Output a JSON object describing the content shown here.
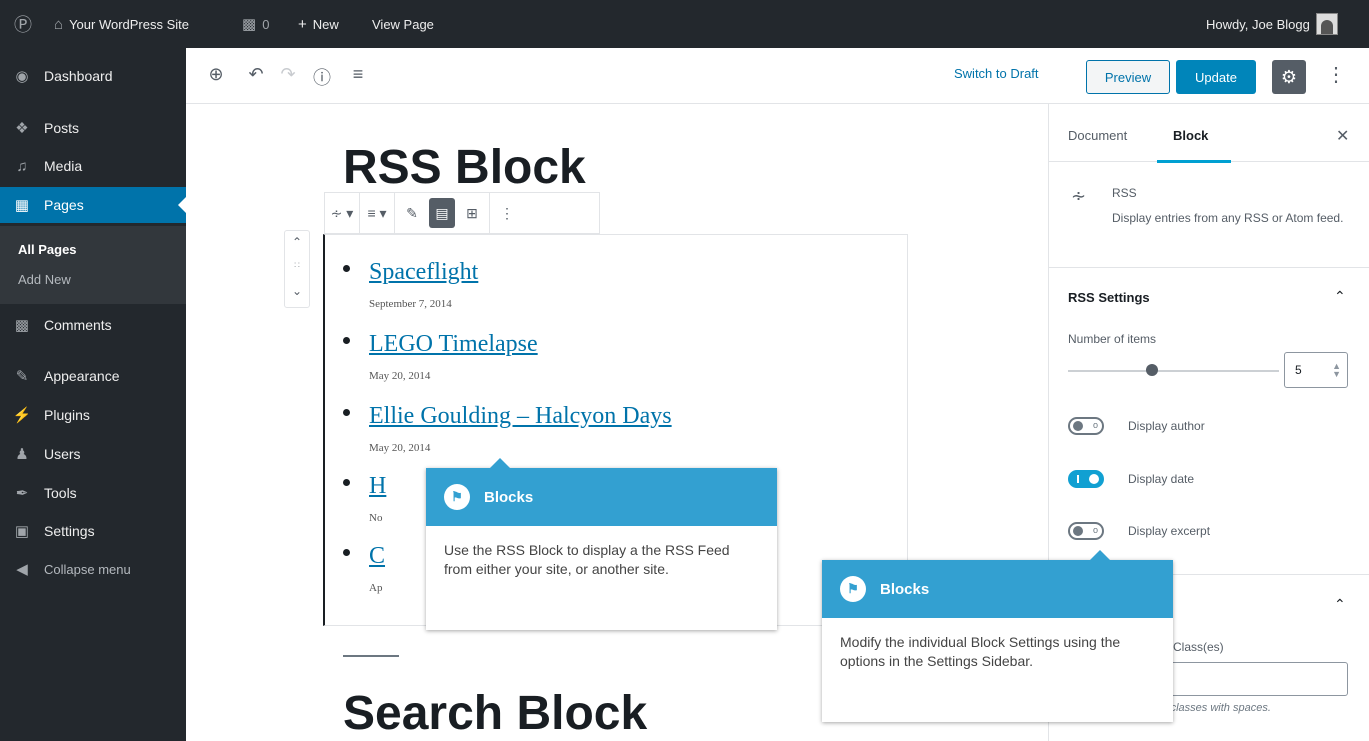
{
  "admin_bar": {
    "site_name": "Your WordPress Site",
    "comments_count": "0",
    "new_label": "New",
    "view_page_label": "View Page",
    "howdy": "Howdy, Joe Blogg"
  },
  "sidebar": {
    "items": [
      {
        "label": "Dashboard",
        "icon": "dashboard-icon"
      },
      {
        "label": "Posts",
        "icon": "pin-icon"
      },
      {
        "label": "Media",
        "icon": "media-icon"
      },
      {
        "label": "Pages",
        "icon": "pages-icon"
      },
      {
        "label": "Comments",
        "icon": "comment-icon"
      },
      {
        "label": "Appearance",
        "icon": "brush-icon"
      },
      {
        "label": "Plugins",
        "icon": "plugin-icon"
      },
      {
        "label": "Users",
        "icon": "users-icon"
      },
      {
        "label": "Tools",
        "icon": "wrench-icon"
      },
      {
        "label": "Settings",
        "icon": "settings-icon"
      },
      {
        "label": "Collapse menu",
        "icon": "collapse-icon"
      }
    ],
    "submenu": [
      "All Pages",
      "Add New"
    ]
  },
  "editor_header": {
    "switch_to_draft": "Switch to Draft",
    "preview": "Preview",
    "update": "Update"
  },
  "content": {
    "rss_title": "RSS Block",
    "search_title": "Search Block",
    "rss_entries": [
      {
        "title": "Spaceflight",
        "date": "September 7, 2014"
      },
      {
        "title": "LEGO Timelapse",
        "date": "May 20, 2014"
      },
      {
        "title": "Ellie Goulding – Halcyon Days",
        "date": "May 20, 2014"
      },
      {
        "title": "H",
        "date": "No"
      },
      {
        "title": "C",
        "date": "Ap"
      }
    ]
  },
  "settings_sidebar": {
    "tab_document": "Document",
    "tab_block": "Block",
    "block_name": "RSS",
    "block_description": "Display entries from any RSS or Atom feed.",
    "panel_title": "RSS Settings",
    "number_of_items_label": "Number of items",
    "number_of_items_value": "5",
    "number_of_items_fraction": 0.4,
    "toggles": [
      {
        "label": "Display author",
        "on": false
      },
      {
        "label": "Display date",
        "on": true
      },
      {
        "label": "Display excerpt",
        "on": false
      }
    ],
    "css_class_label": "Class(es)",
    "css_help": "le classes with spaces."
  },
  "tooltips": [
    {
      "heading": "Blocks",
      "body": "Use the RSS Block to display a the RSS Feed from either your site, or another site."
    },
    {
      "heading": "Blocks",
      "body": "Modify the individual Block Settings using the options in the Settings Sidebar."
    }
  ],
  "colors": {
    "admin_dark": "#23282d",
    "accent_blue": "#0073aa",
    "tooltip_blue": "#33a0d1",
    "toggle_on": "#11a0d2"
  }
}
